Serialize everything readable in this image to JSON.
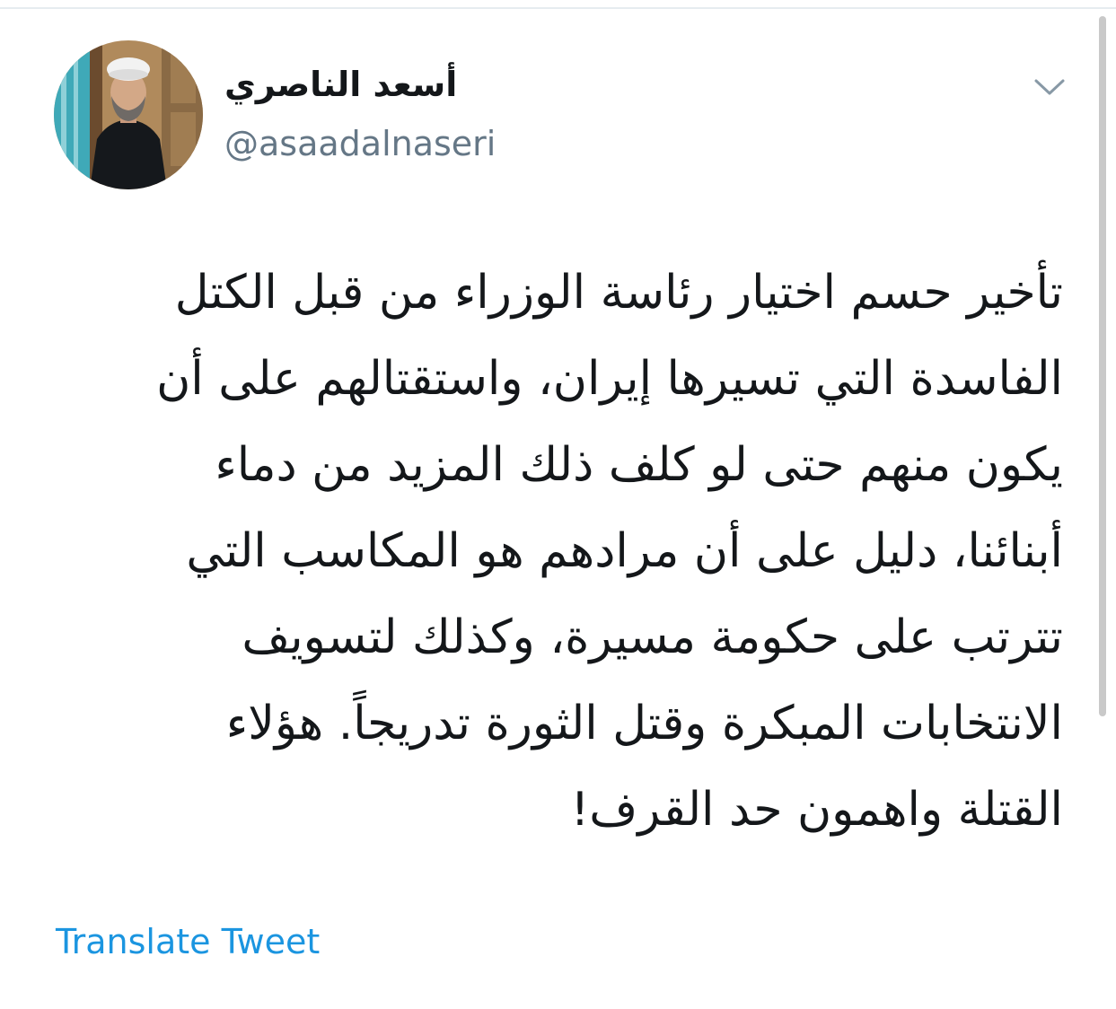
{
  "tweet": {
    "author": {
      "display_name": "أسعد الناصري",
      "handle": "@asaadalnaseri"
    },
    "menu_icon": "chevron-down-icon",
    "text_lines": [
      "تأخير حسم اختيار رئاسة الوزراء من قبل الكتل",
      "الفاسدة التي تسيرها إيران، واستقتالهم على أن",
      "يكون منهم حتى لو كلف ذلك المزيد من دماء",
      "أبنائنا، دليل على أن مرادهم هو المكاسب التي",
      "تترتب على حكومة مسيرة، وكذلك لتسويف",
      "الانتخابات المبكرة وقتل الثورة تدريجاً. هؤلاء",
      "القتلة واهمون حد القرف!"
    ],
    "translate_label": "Translate Tweet"
  },
  "colors": {
    "text_primary": "#14171a",
    "text_secondary": "#657786",
    "link": "#1b95e0",
    "divider": "#e6ecf0"
  }
}
